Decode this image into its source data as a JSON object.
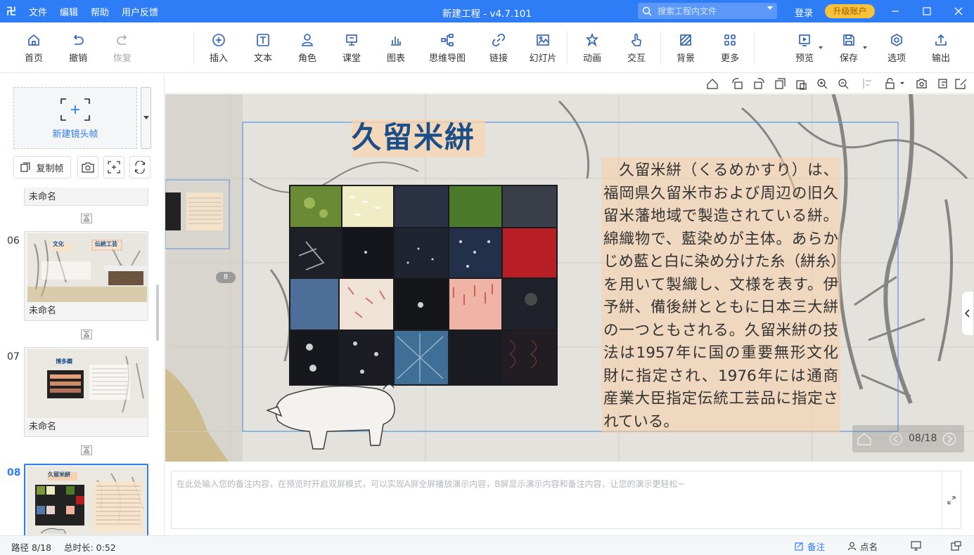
{
  "titlebar": {
    "logo": "卍",
    "menus": [
      "文件",
      "编辑",
      "帮助",
      "用户反馈"
    ],
    "title": "新建工程 - v4.7.101",
    "search_placeholder": "搜索工程内文件",
    "login": "登录",
    "upgrade": "升级账户"
  },
  "toolbar": {
    "items": [
      {
        "label": "首页",
        "icon": "home-icon"
      },
      {
        "label": "撤销",
        "icon": "undo-icon"
      },
      {
        "label": "恢复",
        "icon": "redo-icon",
        "disabled": true
      },
      {
        "label": "插入",
        "icon": "plus-circle-icon"
      },
      {
        "label": "文本",
        "icon": "text-icon"
      },
      {
        "label": "角色",
        "icon": "person-icon"
      },
      {
        "label": "课堂",
        "icon": "classroom-icon"
      },
      {
        "label": "图表",
        "icon": "chart-icon"
      },
      {
        "label": "思维导图",
        "icon": "mindmap-icon"
      },
      {
        "label": "链接",
        "icon": "link-icon"
      },
      {
        "label": "幻灯片",
        "icon": "slide-icon"
      },
      {
        "label": "动画",
        "icon": "star-icon"
      },
      {
        "label": "交互",
        "icon": "hand-icon"
      },
      {
        "label": "背景",
        "icon": "background-icon"
      },
      {
        "label": "更多",
        "icon": "grid-icon"
      },
      {
        "label": "预览",
        "icon": "play-icon"
      },
      {
        "label": "保存",
        "icon": "save-icon"
      },
      {
        "label": "选项",
        "icon": "gear-icon"
      },
      {
        "label": "输出",
        "icon": "upload-icon"
      }
    ]
  },
  "sidebar": {
    "new_frame": "新建镜头帧",
    "copy_frame": "复制帧",
    "partial_name": "未命名",
    "slides": [
      {
        "num": "06",
        "name": "未命名",
        "t1": "文化",
        "t2": "伝統工芸"
      },
      {
        "num": "07",
        "name": "未命名",
        "t1": "博多織"
      },
      {
        "num": "08",
        "name": "",
        "t1": "久留米絣"
      }
    ]
  },
  "canvas": {
    "slide_title": "久留米絣",
    "body_text": "　久留米絣（くるめかすり）は、福岡県久留米市および周辺の旧久留米藩地域で製造されている絣。綿織物で、藍染めが主体。あらかじめ藍と白に染め分けた糸（絣糸）を用いて製織し、文様を表す。伊予絣、備後絣とともに日本三大絣の一つともされる。久留米絣の技法は1957年に国の重要無形文化財に指定され、1976年には通商産業大臣指定伝統工芸品に指定されている。",
    "marker": "8",
    "page_counter": "08/18"
  },
  "notes": {
    "placeholder": "在此处输入您的备注内容，在预览时开启双屏模式，可以实现A屏全屏播放演示内容，B屏显示演示内容和备注内容，让您的演示更轻松~"
  },
  "status": {
    "path": "路径 8/18",
    "duration": "总时长: 0:52",
    "notes_btn": "备注",
    "rollcall_btn": "点名"
  }
}
